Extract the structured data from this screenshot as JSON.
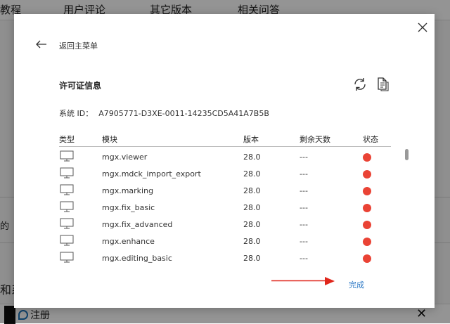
{
  "background": {
    "nav_tabs": [
      "教程",
      "用户评论",
      "其它版本",
      "相关问答"
    ],
    "fragment_left_1": "的",
    "fragment_left_2": "和系",
    "bottom_bar_label": "注册",
    "bottom_bar_close": "✕"
  },
  "dialog": {
    "close_icon": "close-icon",
    "back_label": "返回主菜单",
    "section_title": "许可证信息",
    "system_id_label": "系统 ID：",
    "system_id_value": "A7905771-D3XE-0011-14235CD5A41A7B5B",
    "columns": {
      "type": "类型",
      "module": "模块",
      "version": "版本",
      "days_left": "剩余天数",
      "status": "状态"
    },
    "rows": [
      {
        "module": "mgx.viewer",
        "version": "28.0",
        "days": "---",
        "status_color": "#ea4335"
      },
      {
        "module": "mgx.mdck_import_export",
        "version": "28.0",
        "days": "---",
        "status_color": "#ea4335"
      },
      {
        "module": "mgx.marking",
        "version": "28.0",
        "days": "---",
        "status_color": "#ea4335"
      },
      {
        "module": "mgx.fix_basic",
        "version": "28.0",
        "days": "---",
        "status_color": "#ea4335"
      },
      {
        "module": "mgx.fix_advanced",
        "version": "28.0",
        "days": "---",
        "status_color": "#ea4335"
      },
      {
        "module": "mgx.enhance",
        "version": "28.0",
        "days": "---",
        "status_color": "#ea4335"
      },
      {
        "module": "mgx.editing_basic",
        "version": "28.0",
        "days": "---",
        "status_color": "#ea4335"
      }
    ],
    "done_label": "完成"
  },
  "colors": {
    "status_red": "#ea4335",
    "link_blue": "#2b78c5",
    "annotation_arrow": "#e0261b"
  }
}
